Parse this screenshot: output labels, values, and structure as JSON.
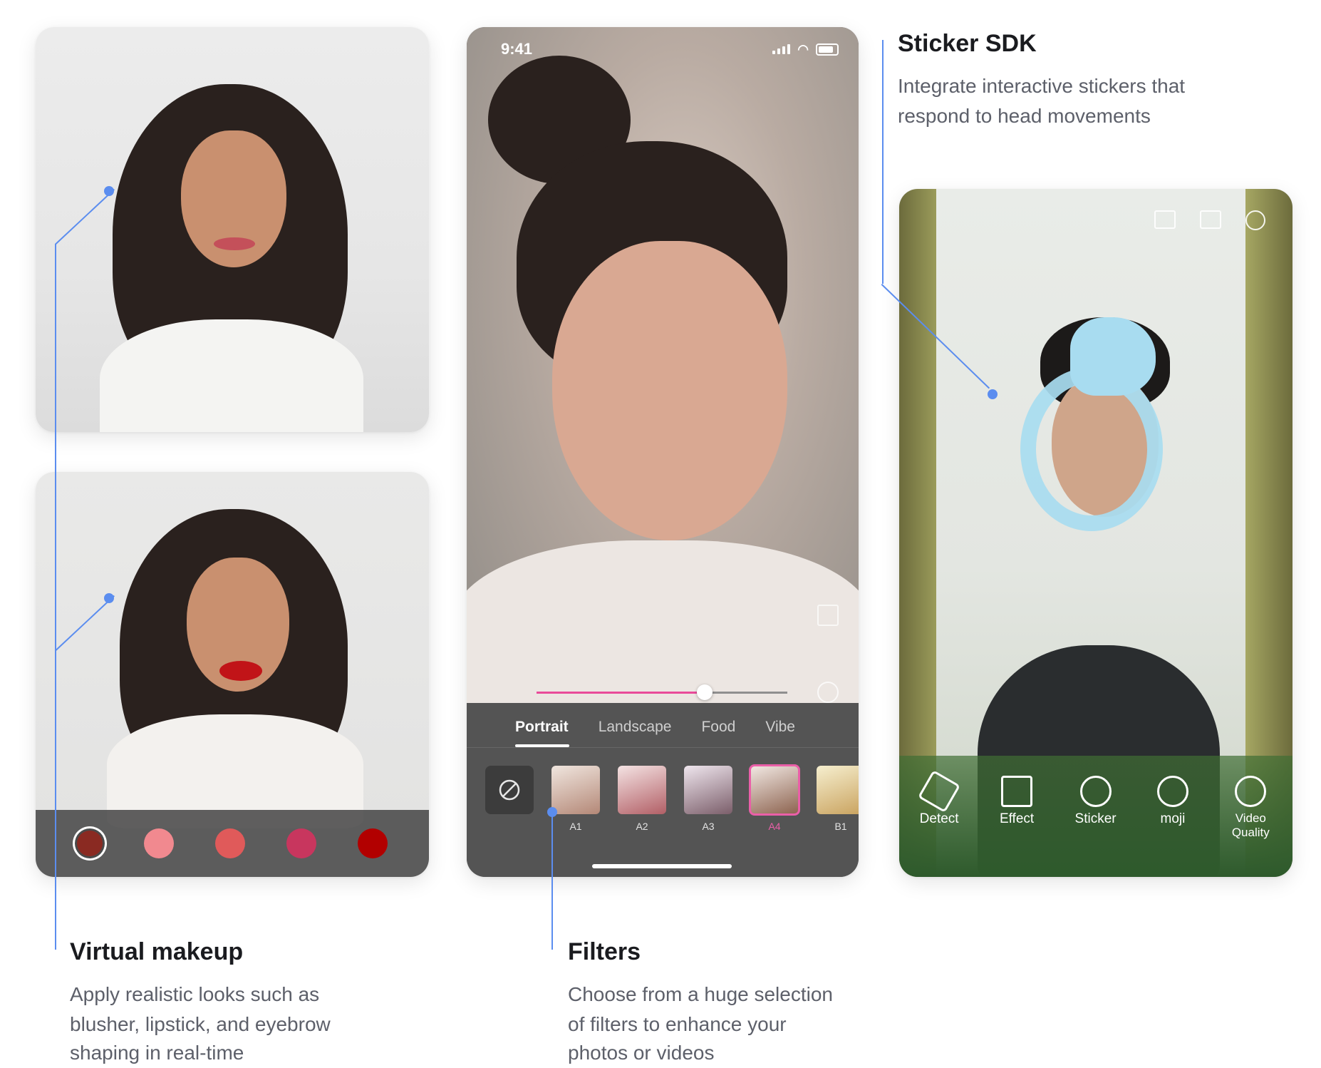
{
  "sticker": {
    "title": "Sticker SDK",
    "description_line1": "Integrate interactive stickers that",
    "description_line2": "respond to head movements",
    "tools": [
      "Detect",
      "Effect",
      "Sticker",
      "moji",
      "Video Quality"
    ]
  },
  "makeup": {
    "title": "Virtual makeup",
    "description_line1": "Apply realistic looks such as",
    "description_line2": "blusher, lipstick, and eyebrow",
    "description_line3": "shaping in real-time",
    "swatches": [
      "#8a2a22",
      "#f1898f",
      "#e05a5a",
      "#c8365e",
      "#b20000"
    ],
    "selected_swatch_index": 0
  },
  "filters": {
    "title": "Filters",
    "description_line1": "Choose from a huge selection",
    "description_line2": "of filters to enhance your",
    "description_line3": "photos or videos",
    "time": "9:41",
    "tabs": [
      "Portrait",
      "Landscape",
      "Food",
      "Vibe"
    ],
    "active_tab": "Portrait",
    "thumbnails": [
      "A1",
      "A2",
      "A3",
      "A4",
      "B1"
    ],
    "selected_thumbnail": "A4",
    "intensity": 0.67
  },
  "colors": {
    "accent": "#5b8def",
    "slider": "#e94b9a",
    "selected_filter": "#ea5fa8"
  }
}
